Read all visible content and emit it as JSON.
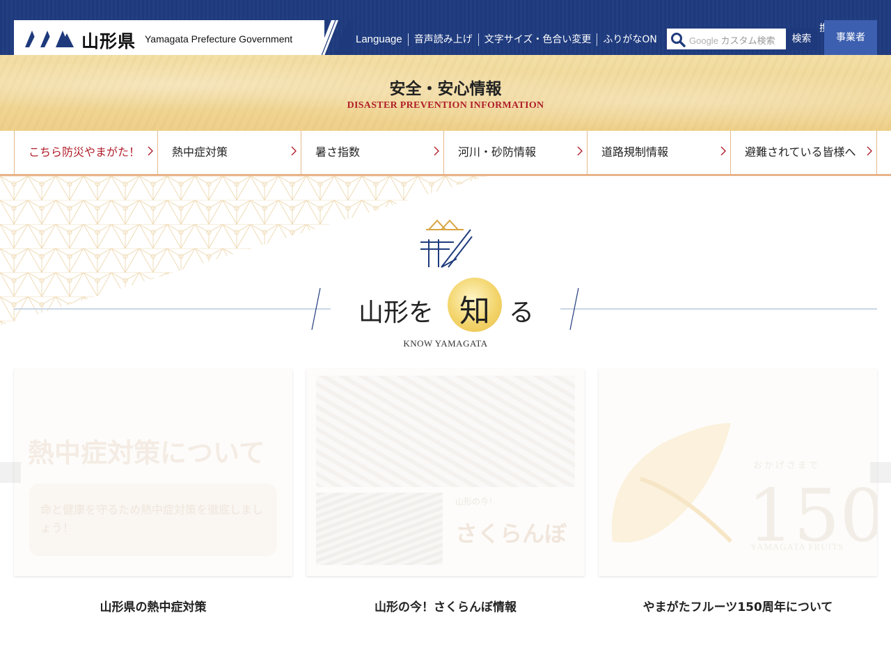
{
  "header": {
    "logo_jp": "山形県",
    "logo_en": "Yamagata Prefecture Government",
    "links": [
      "Language",
      "音声読み上げ",
      "文字サイズ・色合い変更",
      "ふりがなON"
    ],
    "search": {
      "brand": "Google",
      "placeholder": "カスタム検索",
      "button": "検索"
    },
    "cut_char": "携",
    "business_button": "事業者"
  },
  "disaster": {
    "title": "安全・安心情報",
    "subtitle": "DISASTER PREVENTION INFORMATION",
    "tabs": [
      "こちら防災やまがた！",
      "熱中症対策",
      "暑さ指数",
      "河川・砂防情報",
      "道路規制情報",
      "避難されている皆様へ"
    ]
  },
  "know": {
    "title_part1": "山形を",
    "title_circle": "知",
    "title_part3": "る",
    "subtitle": "KNOW YAMAGATA"
  },
  "cards": [
    {
      "caption": "山形県の熱中症対策",
      "img_heading": "熱中症対策について",
      "img_text": "命と健康を守るため熱中症対策を徹底しましょう！"
    },
    {
      "caption": "山形の今！さくらんぼ情報",
      "img_small": "山形の今！",
      "img_big": "さくらんぼ"
    },
    {
      "caption": "やまがたフルーツ150周年について",
      "img_num": "150",
      "img_year": "おかげさまで",
      "img_en": "YAMAGATA FRUITS"
    }
  ],
  "colors": {
    "navy": "#1f3a7c",
    "accent_red": "#b01e2a",
    "gold": "#eed08a",
    "tab_border": "#e6b88a"
  }
}
